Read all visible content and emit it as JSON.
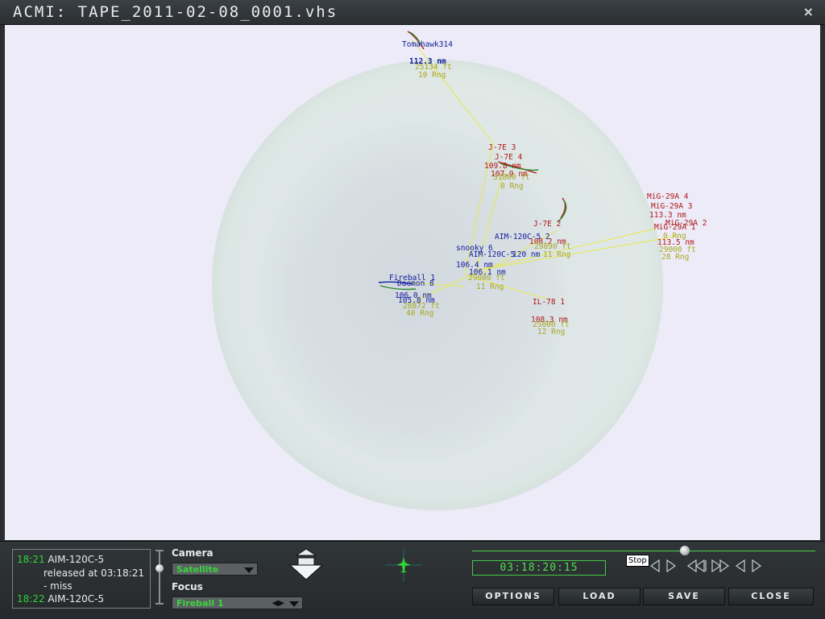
{
  "window": {
    "title": "ACMI:  TAPE_2011-02-08_0001.vhs",
    "close": "×"
  },
  "map": {
    "labels": [
      {
        "text": "Tomahawk314",
        "color": "blue"
      },
      {
        "text": "112.3 nm",
        "color": "blue"
      },
      {
        "text": "25134 ft",
        "color": "yel"
      },
      {
        "text": "10 Rng",
        "color": "yel"
      },
      {
        "text": "J-7E 3",
        "color": "red"
      },
      {
        "text": "J-7E 4",
        "color": "red"
      },
      {
        "text": "109.8 nm",
        "color": "red"
      },
      {
        "text": "107.9 nm",
        "color": "red"
      },
      {
        "text": "31880 ft",
        "color": "yel"
      },
      {
        "text": "0 Rng",
        "color": "yel"
      },
      {
        "text": "MiG-29A 4",
        "color": "red"
      },
      {
        "text": "MiG-29A 3",
        "color": "red"
      },
      {
        "text": "113.3 nm",
        "color": "red"
      },
      {
        "text": "MiG-29A 2",
        "color": "red"
      },
      {
        "text": "MiG-29A 1",
        "color": "red"
      },
      {
        "text": "113.5 nm",
        "color": "red"
      },
      {
        "text": "0 Rng",
        "color": "yel"
      },
      {
        "text": "29000 ft",
        "color": "yel"
      },
      {
        "text": "28 Rng",
        "color": "yel"
      },
      {
        "text": "J-7E 2",
        "color": "red"
      },
      {
        "text": "AIM-120C-5 2",
        "color": "blue"
      },
      {
        "text": "108.2 nm",
        "color": "red"
      },
      {
        "text": "29890 ft",
        "color": "yel"
      },
      {
        "text": "11 Rng",
        "color": "yel"
      },
      {
        "text": "snooky 6",
        "color": "blue"
      },
      {
        "text": "AIM-120C-5",
        "color": "blue"
      },
      {
        "text": "120 nm",
        "color": "blue"
      },
      {
        "text": "106.4 nm",
        "color": "blue"
      },
      {
        "text": "106.1 nm",
        "color": "blue"
      },
      {
        "text": "29000 ft",
        "color": "yel"
      },
      {
        "text": "11 Rng",
        "color": "yel"
      },
      {
        "text": "Fireball 1",
        "color": "blue"
      },
      {
        "text": "Daemon 8",
        "color": "blue"
      },
      {
        "text": "106.0 nm",
        "color": "blue"
      },
      {
        "text": "105.8 nm",
        "color": "blue"
      },
      {
        "text": "28872 ft",
        "color": "yel"
      },
      {
        "text": "40 Rng",
        "color": "yel"
      },
      {
        "text": "IL-78 1",
        "color": "red"
      },
      {
        "text": "108.3 nm",
        "color": "red"
      },
      {
        "text": "25000 ft",
        "color": "yel"
      },
      {
        "text": "12 Rng",
        "color": "yel"
      }
    ]
  },
  "event_log": [
    {
      "time": "18:21",
      "text": "AIM-120C-5"
    },
    {
      "time": "",
      "text": "released at 03:18:21"
    },
    {
      "time": "",
      "text": "- miss"
    },
    {
      "time": "18:22",
      "text": "AIM-120C-5"
    }
  ],
  "camera": {
    "label": "Camera",
    "value": "Satellite"
  },
  "focus": {
    "label": "Focus",
    "value": "Fireball 1"
  },
  "playback": {
    "time": "03:18:20:15",
    "tooltip": "Stop",
    "progress": 0.61
  },
  "buttons": {
    "options": "OPTIONS",
    "load": "LOAD",
    "save": "SAVE",
    "close": "CLOSE"
  },
  "colors": {
    "blue": "#101a9c",
    "red": "#b01818",
    "yel": "#a8a820",
    "lines": "#eaea4a",
    "accent": "#39d63c"
  }
}
